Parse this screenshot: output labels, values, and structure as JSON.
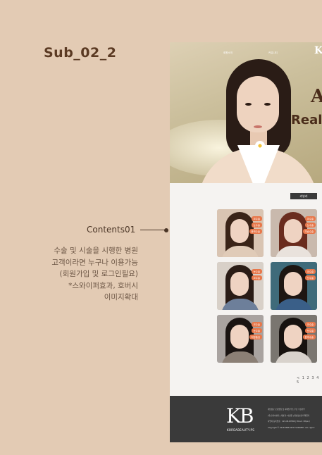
{
  "page": {
    "title": "Sub_02_2"
  },
  "annotation": {
    "label": "Contents01",
    "description_lines": [
      "수술 및 시술을 시행한 병원",
      "고객이라면 누구나 이용가능",
      "(회원가입 및 로그인필요)",
      "*스와이퍼효과, 호버시",
      "이미지확대"
    ]
  },
  "mockup": {
    "nav": [
      "회원소개",
      "커뮤니티"
    ],
    "hero_logo": "K",
    "hero_letter": "A",
    "hero_text": "Real",
    "section_tag": "리뷰리",
    "cards": [
      {
        "tags": [
          "코수술",
          "눈수술",
          "윤곽수술"
        ],
        "bg": "#d9c4b2",
        "hair": "#3a2418",
        "body": "#e0cbb8"
      },
      {
        "tags": [
          "코수술",
          "눈수술",
          "가슴수술"
        ],
        "bg": "#c9b9ad",
        "hair": "#6a2c1e",
        "body": "#e9e2dc"
      },
      {
        "tags": [
          "눈수술",
          "코수술"
        ],
        "bg": "#d8d0c8",
        "hair": "#2a1c16",
        "body": "#6d7f9a"
      },
      {
        "tags": [
          "코수술",
          "눈수술"
        ],
        "bg": "#3f6b7a",
        "hair": "#1e1612",
        "body": "#3a5f88"
      },
      {
        "tags": [
          "코수술",
          "눈수술",
          "지방흡입"
        ],
        "bg": "#a9a3a0",
        "hair": "#1a1412",
        "body": "#8b7f75"
      },
      {
        "tags": [
          "코수술",
          "눈수술",
          "윤곽수술"
        ],
        "bg": "#7a7670",
        "hair": "#17120f",
        "body": "#d8d2cc"
      }
    ],
    "pagination": "< 1 2 3 4 5",
    "footer": {
      "logo": "KB",
      "subtitle": "KOREABEAUTY.PS",
      "info_lines": [
        "개인정보 보호방침 및 이메일 주소 무단 수집거부",
        "(주)코리아뷰티 | 대표자: 이정원 | 개인정보관리책임자",
        "사업자 등록번호 : 123-45-67890 | Email : https://",
        "Copyright © 2018 KBPLASTIC SURGERY, ALL right r"
      ]
    }
  }
}
